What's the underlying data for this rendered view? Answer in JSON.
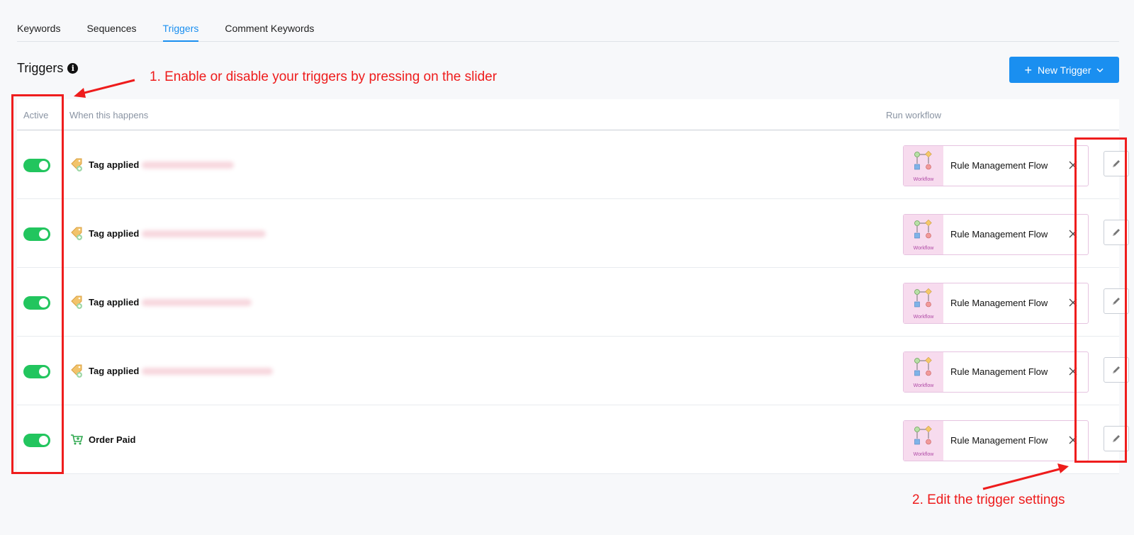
{
  "tabs": [
    {
      "label": "Keywords"
    },
    {
      "label": "Sequences"
    },
    {
      "label": "Triggers",
      "active": true
    },
    {
      "label": "Comment Keywords"
    }
  ],
  "page": {
    "title": "Triggers",
    "info_icon": "info-icon",
    "new_trigger_label": "New Trigger"
  },
  "table": {
    "columns": {
      "active": "Active",
      "when": "When this happens",
      "run": "Run workflow"
    },
    "rows": [
      {
        "active": true,
        "icon": "tag-icon",
        "trigger": "Tag applied",
        "workflow": "Rule Management Flow",
        "workflow_caption": "Workflow"
      },
      {
        "active": true,
        "icon": "tag-icon",
        "trigger": "Tag applied",
        "workflow": "Rule Management Flow",
        "workflow_caption": "Workflow"
      },
      {
        "active": true,
        "icon": "tag-icon",
        "trigger": "Tag applied",
        "workflow": "Rule Management Flow",
        "workflow_caption": "Workflow"
      },
      {
        "active": true,
        "icon": "tag-icon",
        "trigger": "Tag applied",
        "workflow": "Rule Management Flow",
        "workflow_caption": "Workflow"
      },
      {
        "active": true,
        "icon": "cart-icon",
        "trigger": "Order Paid",
        "workflow": "Rule Management Flow",
        "workflow_caption": "Workflow"
      }
    ]
  },
  "annotations": {
    "note1": "1. Enable or disable your triggers by pressing on the slider",
    "note2": "2. Edit the trigger settings",
    "color": "#ee1c1c"
  },
  "colors": {
    "accent": "#1a8ff0",
    "toggle_on": "#22c55e",
    "workflow_bg": "#f7dbee"
  }
}
